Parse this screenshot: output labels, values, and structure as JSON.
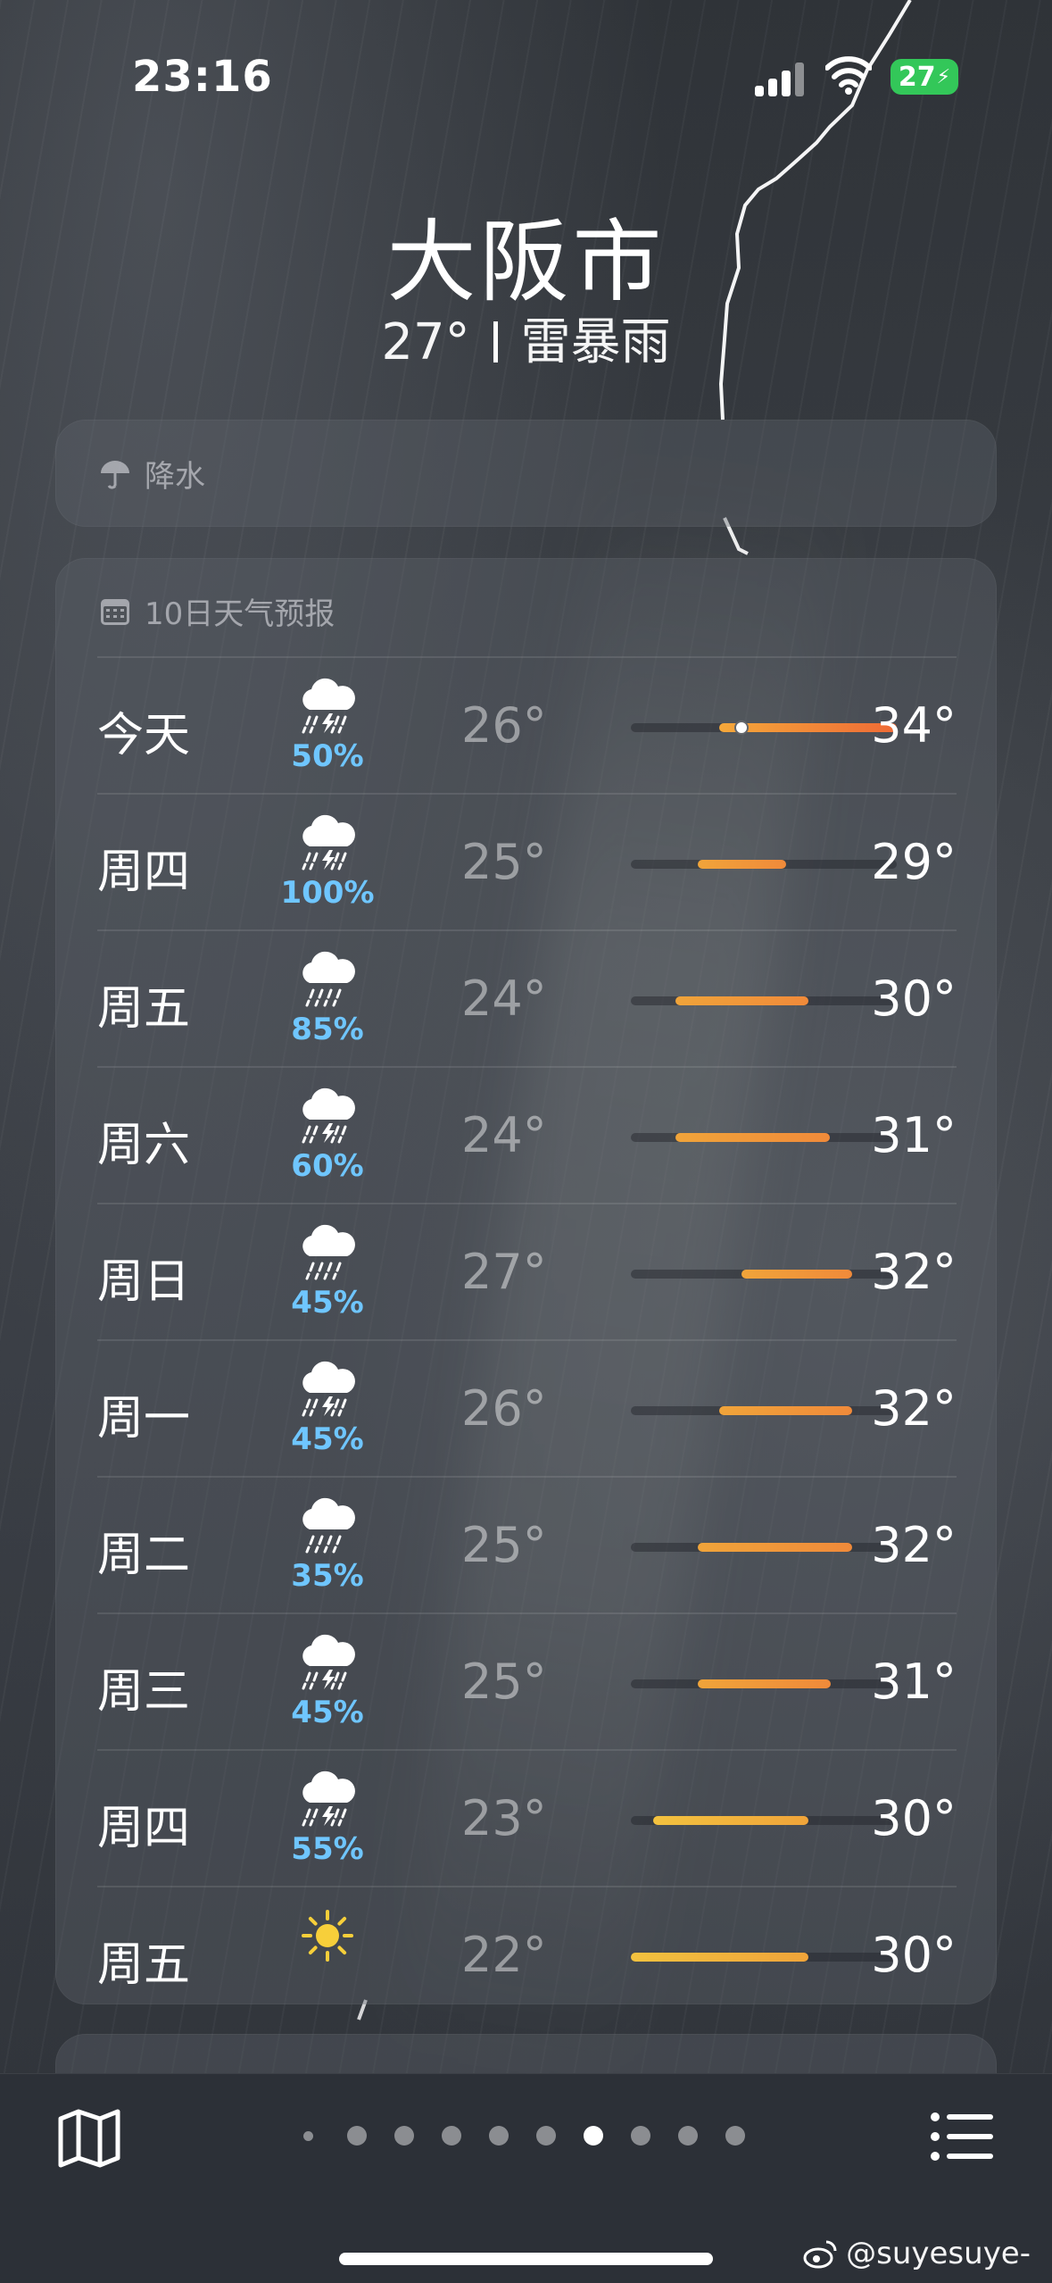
{
  "status_bar": {
    "time": "23:16",
    "battery": "27"
  },
  "location": {
    "city": "大阪市",
    "temperature": "27°",
    "condition": "雷暴雨"
  },
  "precip_card": {
    "title": "降水"
  },
  "forecast": {
    "title": "10日天气预报",
    "scale_min": 22,
    "scale_max": 34,
    "current_temp": 27,
    "days": [
      {
        "day": "今天",
        "icon": "thunderstorm-night-icon",
        "chance": "50%",
        "low_label": "26°",
        "high_label": "34°",
        "low": 26,
        "high": 34
      },
      {
        "day": "周四",
        "icon": "thunderstorm-icon",
        "chance": "100%",
        "low_label": "25°",
        "high_label": "29°",
        "low": 25,
        "high": 29
      },
      {
        "day": "周五",
        "icon": "rain-icon",
        "chance": "85%",
        "low_label": "24°",
        "high_label": "30°",
        "low": 24,
        "high": 30
      },
      {
        "day": "周六",
        "icon": "thunderstorm-icon",
        "chance": "60%",
        "low_label": "24°",
        "high_label": "31°",
        "low": 24,
        "high": 31
      },
      {
        "day": "周日",
        "icon": "rain-icon",
        "chance": "45%",
        "low_label": "27°",
        "high_label": "32°",
        "low": 27,
        "high": 32
      },
      {
        "day": "周一",
        "icon": "thunderstorm-icon",
        "chance": "45%",
        "low_label": "26°",
        "high_label": "32°",
        "low": 26,
        "high": 32
      },
      {
        "day": "周二",
        "icon": "rain-icon",
        "chance": "35%",
        "low_label": "25°",
        "high_label": "32°",
        "low": 25,
        "high": 32
      },
      {
        "day": "周三",
        "icon": "thunderstorm-icon",
        "chance": "45%",
        "low_label": "25°",
        "high_label": "31°",
        "low": 25,
        "high": 31
      },
      {
        "day": "周四",
        "icon": "thunderstorm-icon",
        "chance": "55%",
        "low_label": "23°",
        "high_label": "30°",
        "low": 23,
        "high": 30
      },
      {
        "day": "周五",
        "icon": "sunny-icon",
        "chance": "",
        "low_label": "22°",
        "high_label": "30°",
        "low": 22,
        "high": 30
      }
    ]
  },
  "colors": {
    "precip_text": "#6fc6ff",
    "warm": "#f0a43a",
    "hot": "#ef6a36",
    "mild": "#f3c23f"
  },
  "pager": {
    "count": 10,
    "active": 6
  },
  "watermark": "@suyesuye-"
}
